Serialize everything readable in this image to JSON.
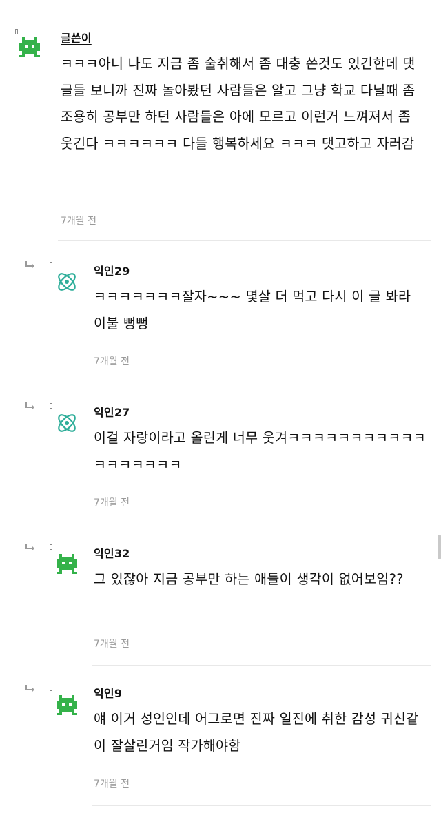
{
  "comments": [
    {
      "author": "글쓴이",
      "avatar_icon": "green-robot-icon",
      "body": "ㅋㅋㅋ아니 나도 지금 좀 술취해서 좀 대충 쓴것도 있긴한데 댓글들 보니까 진짜 놀아봤던 사람들은 알고 그냥 학교 다닐때 좀 조용히 공부만 하던 사람들은 아에 모르고 이런거 느껴져서 좀 웃긴다 ㅋㅋㅋㅋㅋㅋ 다들 행복하세요 ㅋㅋㅋ 댓고하고 자러감",
      "time": "7개월 전"
    },
    {
      "author": "익인29",
      "avatar_icon": "teal-atom-icon",
      "body": "ㅋㅋㅋㅋㅋㅋㅋ잘자~~~ 몇살 더 먹고 다시 이 글 봐라 이불 뻥뻥",
      "time": "7개월 전"
    },
    {
      "author": "익인27",
      "avatar_icon": "teal-atom-icon",
      "body": "이걸 자랑이라고 올린게 너무 웃겨ㅋㅋㅋㅋㅋㅋㅋㅋㅋㅋㅋㅋㅋㅋㅋㅋㅋㅋ",
      "time": "7개월 전"
    },
    {
      "author": "익인32",
      "avatar_icon": "green-robot-icon",
      "body": "그 있잖아 지금 공부만 하는 애들이 생각이 없어보임??",
      "time": "7개월 전"
    },
    {
      "author": "익인9",
      "avatar_icon": "green-robot-icon",
      "body": "얘 이거 성인인데 어그로면 진짜 일진에 취한 감성 귀신같이 잘살린거임 작가해야함",
      "time": "7개월 전"
    }
  ],
  "colors": {
    "robot_green": "#34b24a",
    "atom_teal": "#2fae9a",
    "time_gray": "#9a9a9a",
    "divider": "#e8e8e8"
  }
}
